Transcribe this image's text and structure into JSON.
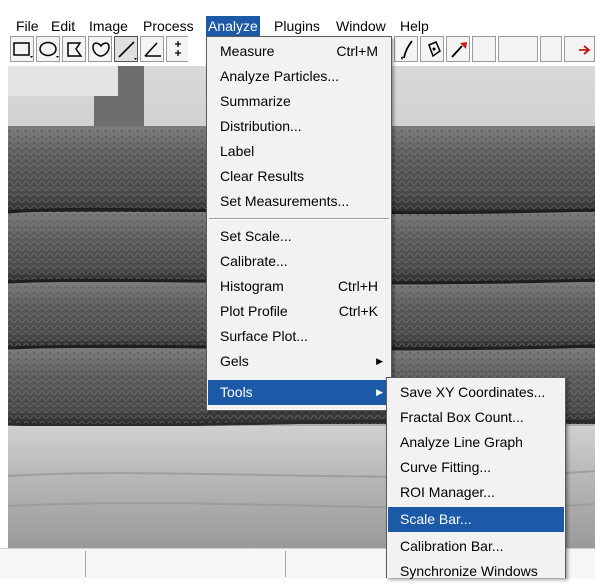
{
  "menubar": {
    "items": [
      "File",
      "Edit",
      "Image",
      "Process",
      "Analyze",
      "Plugins",
      "Window",
      "Help"
    ],
    "active": "Analyze"
  },
  "toolbar": {
    "tools": [
      "rectangle-tool",
      "oval-tool",
      "polygon-tool",
      "freehand-tool",
      "straight-line-tool",
      "angle-tool",
      "point-tool"
    ],
    "right_tools": [
      "brush-tool",
      "flood-fill-tool",
      "color-picker-tool"
    ]
  },
  "analyze_menu": {
    "items": [
      {
        "label": "Measure",
        "shortcut": "Ctrl+M"
      },
      {
        "label": "Analyze Particles..."
      },
      {
        "label": "Summarize"
      },
      {
        "label": "Distribution..."
      },
      {
        "label": "Label"
      },
      {
        "label": "Clear Results"
      },
      {
        "label": "Set Measurements..."
      },
      {
        "label": "Set Scale..."
      },
      {
        "label": "Calibrate..."
      },
      {
        "label": "Histogram",
        "shortcut": "Ctrl+H"
      },
      {
        "label": "Plot Profile",
        "shortcut": "Ctrl+K"
      },
      {
        "label": "Surface Plot..."
      },
      {
        "label": "Gels"
      },
      {
        "label": "Tools"
      }
    ]
  },
  "tools_submenu": {
    "items": [
      "Save XY Coordinates...",
      "Fractal Box Count...",
      "Analyze Line Graph",
      "Curve Fitting...",
      "ROI Manager...",
      "Scale Bar...",
      "Calibration Bar...",
      "Synchronize Windows"
    ],
    "highlighted": "Scale Bar..."
  },
  "colors": {
    "highlight": "#1c5aa8",
    "menu_bg": "#f2f2f2"
  }
}
